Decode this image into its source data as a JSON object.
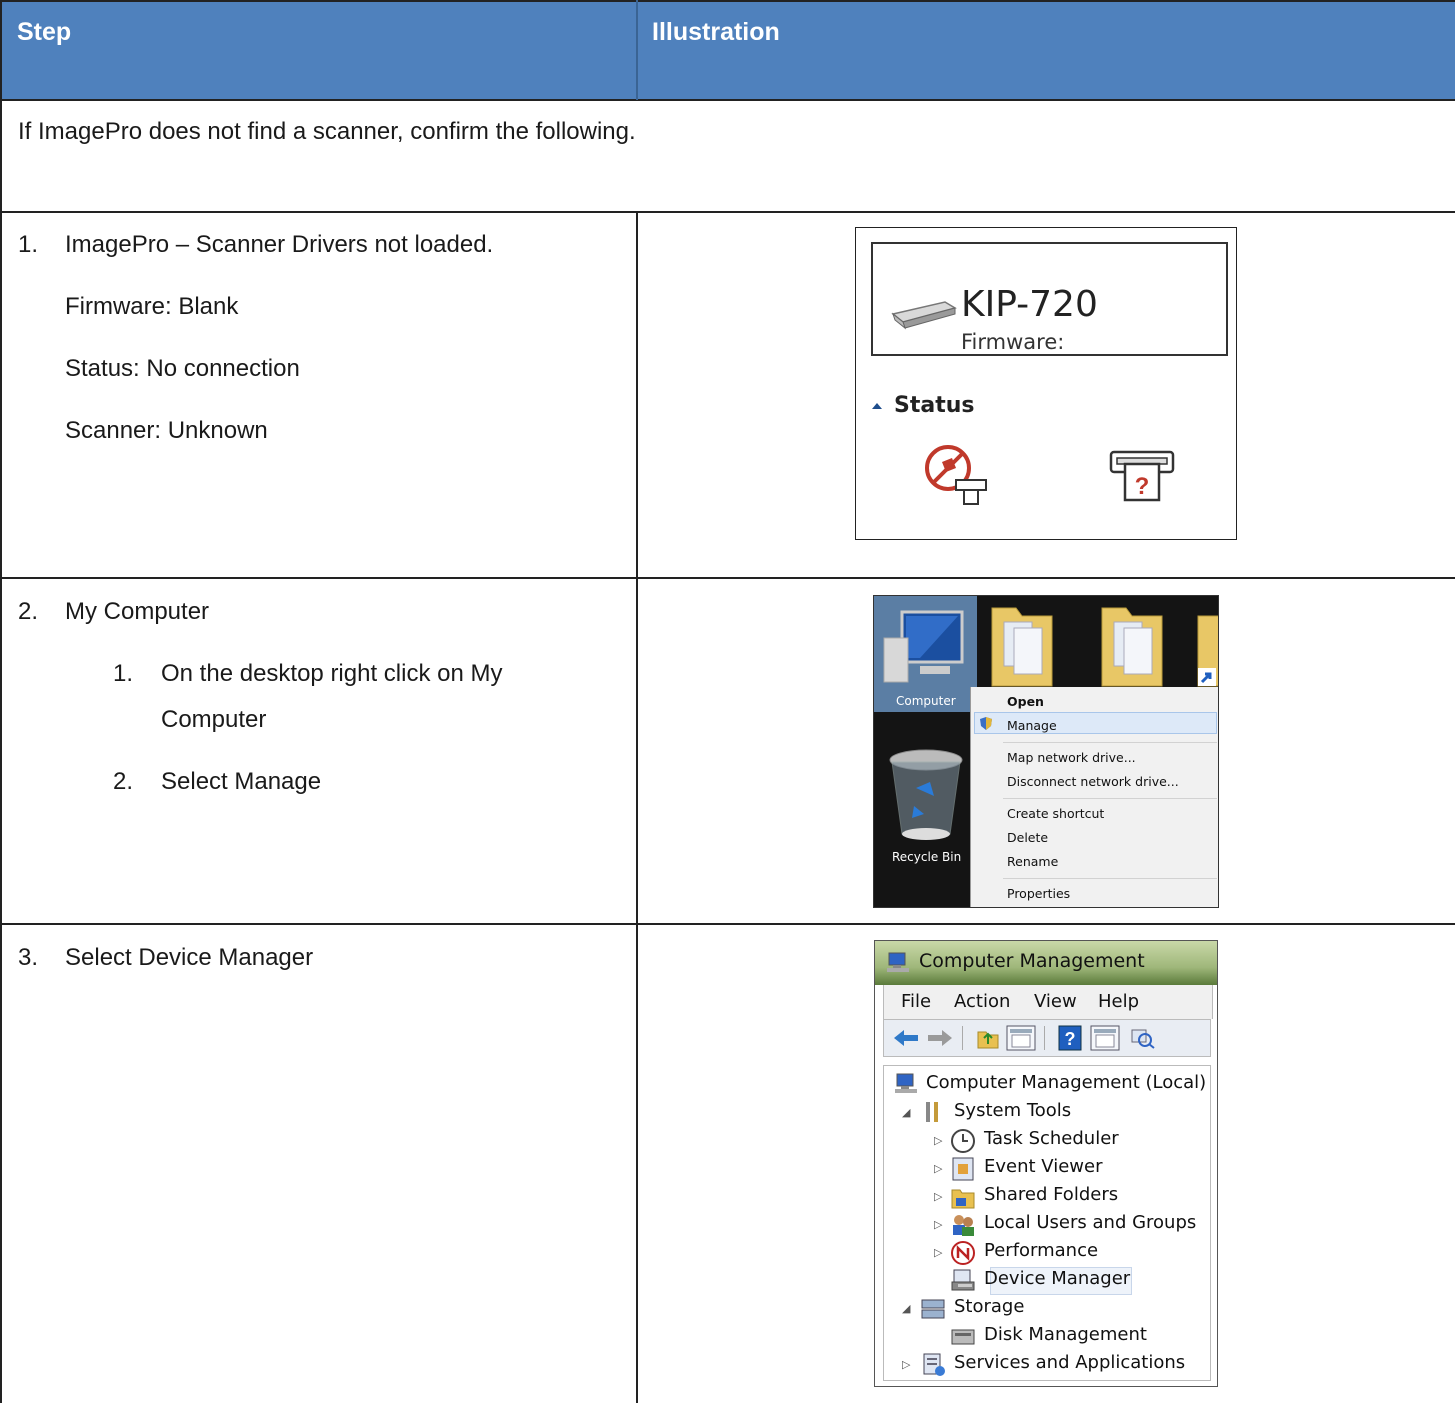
{
  "header": {
    "col1": "Step",
    "col2": "Illustration"
  },
  "intro": "If ImagePro does not find a scanner, confirm the following.",
  "steps": [
    {
      "num": "1.",
      "title": "ImagePro – Scanner Drivers not loaded.",
      "lines": [
        "Firmware: Blank",
        "Status: No connection",
        "Scanner: Unknown"
      ]
    },
    {
      "num": "2.",
      "title": "My Computer",
      "substeps": [
        {
          "num": "1.",
          "text_line1": "On the desktop right click on My",
          "text_line2": "Computer"
        },
        {
          "num": "2.",
          "text_line1": "Select Manage"
        }
      ]
    },
    {
      "num": "3.",
      "title": "Select Device Manager"
    }
  ],
  "ill1": {
    "model": "KIP-720",
    "firmware": "Firmware:",
    "status": "Status"
  },
  "ill2": {
    "computer_label": "Computer",
    "recycle_label": "Recycle Bin",
    "menu": [
      "Open",
      "Manage",
      "Map network drive...",
      "Disconnect network drive...",
      "Create shortcut",
      "Delete",
      "Rename",
      "Properties"
    ]
  },
  "ill3": {
    "title": "Computer Management",
    "menubar": [
      "File",
      "Action",
      "View",
      "Help"
    ],
    "tree": [
      "Computer Management (Local)",
      "System Tools",
      "Task Scheduler",
      "Event Viewer",
      "Shared Folders",
      "Local Users and Groups",
      "Performance",
      "Device Manager",
      "Storage",
      "Disk Management",
      "Services and Applications"
    ]
  },
  "colors": {
    "header_bg": "#4f81bd",
    "border": "#222222"
  }
}
